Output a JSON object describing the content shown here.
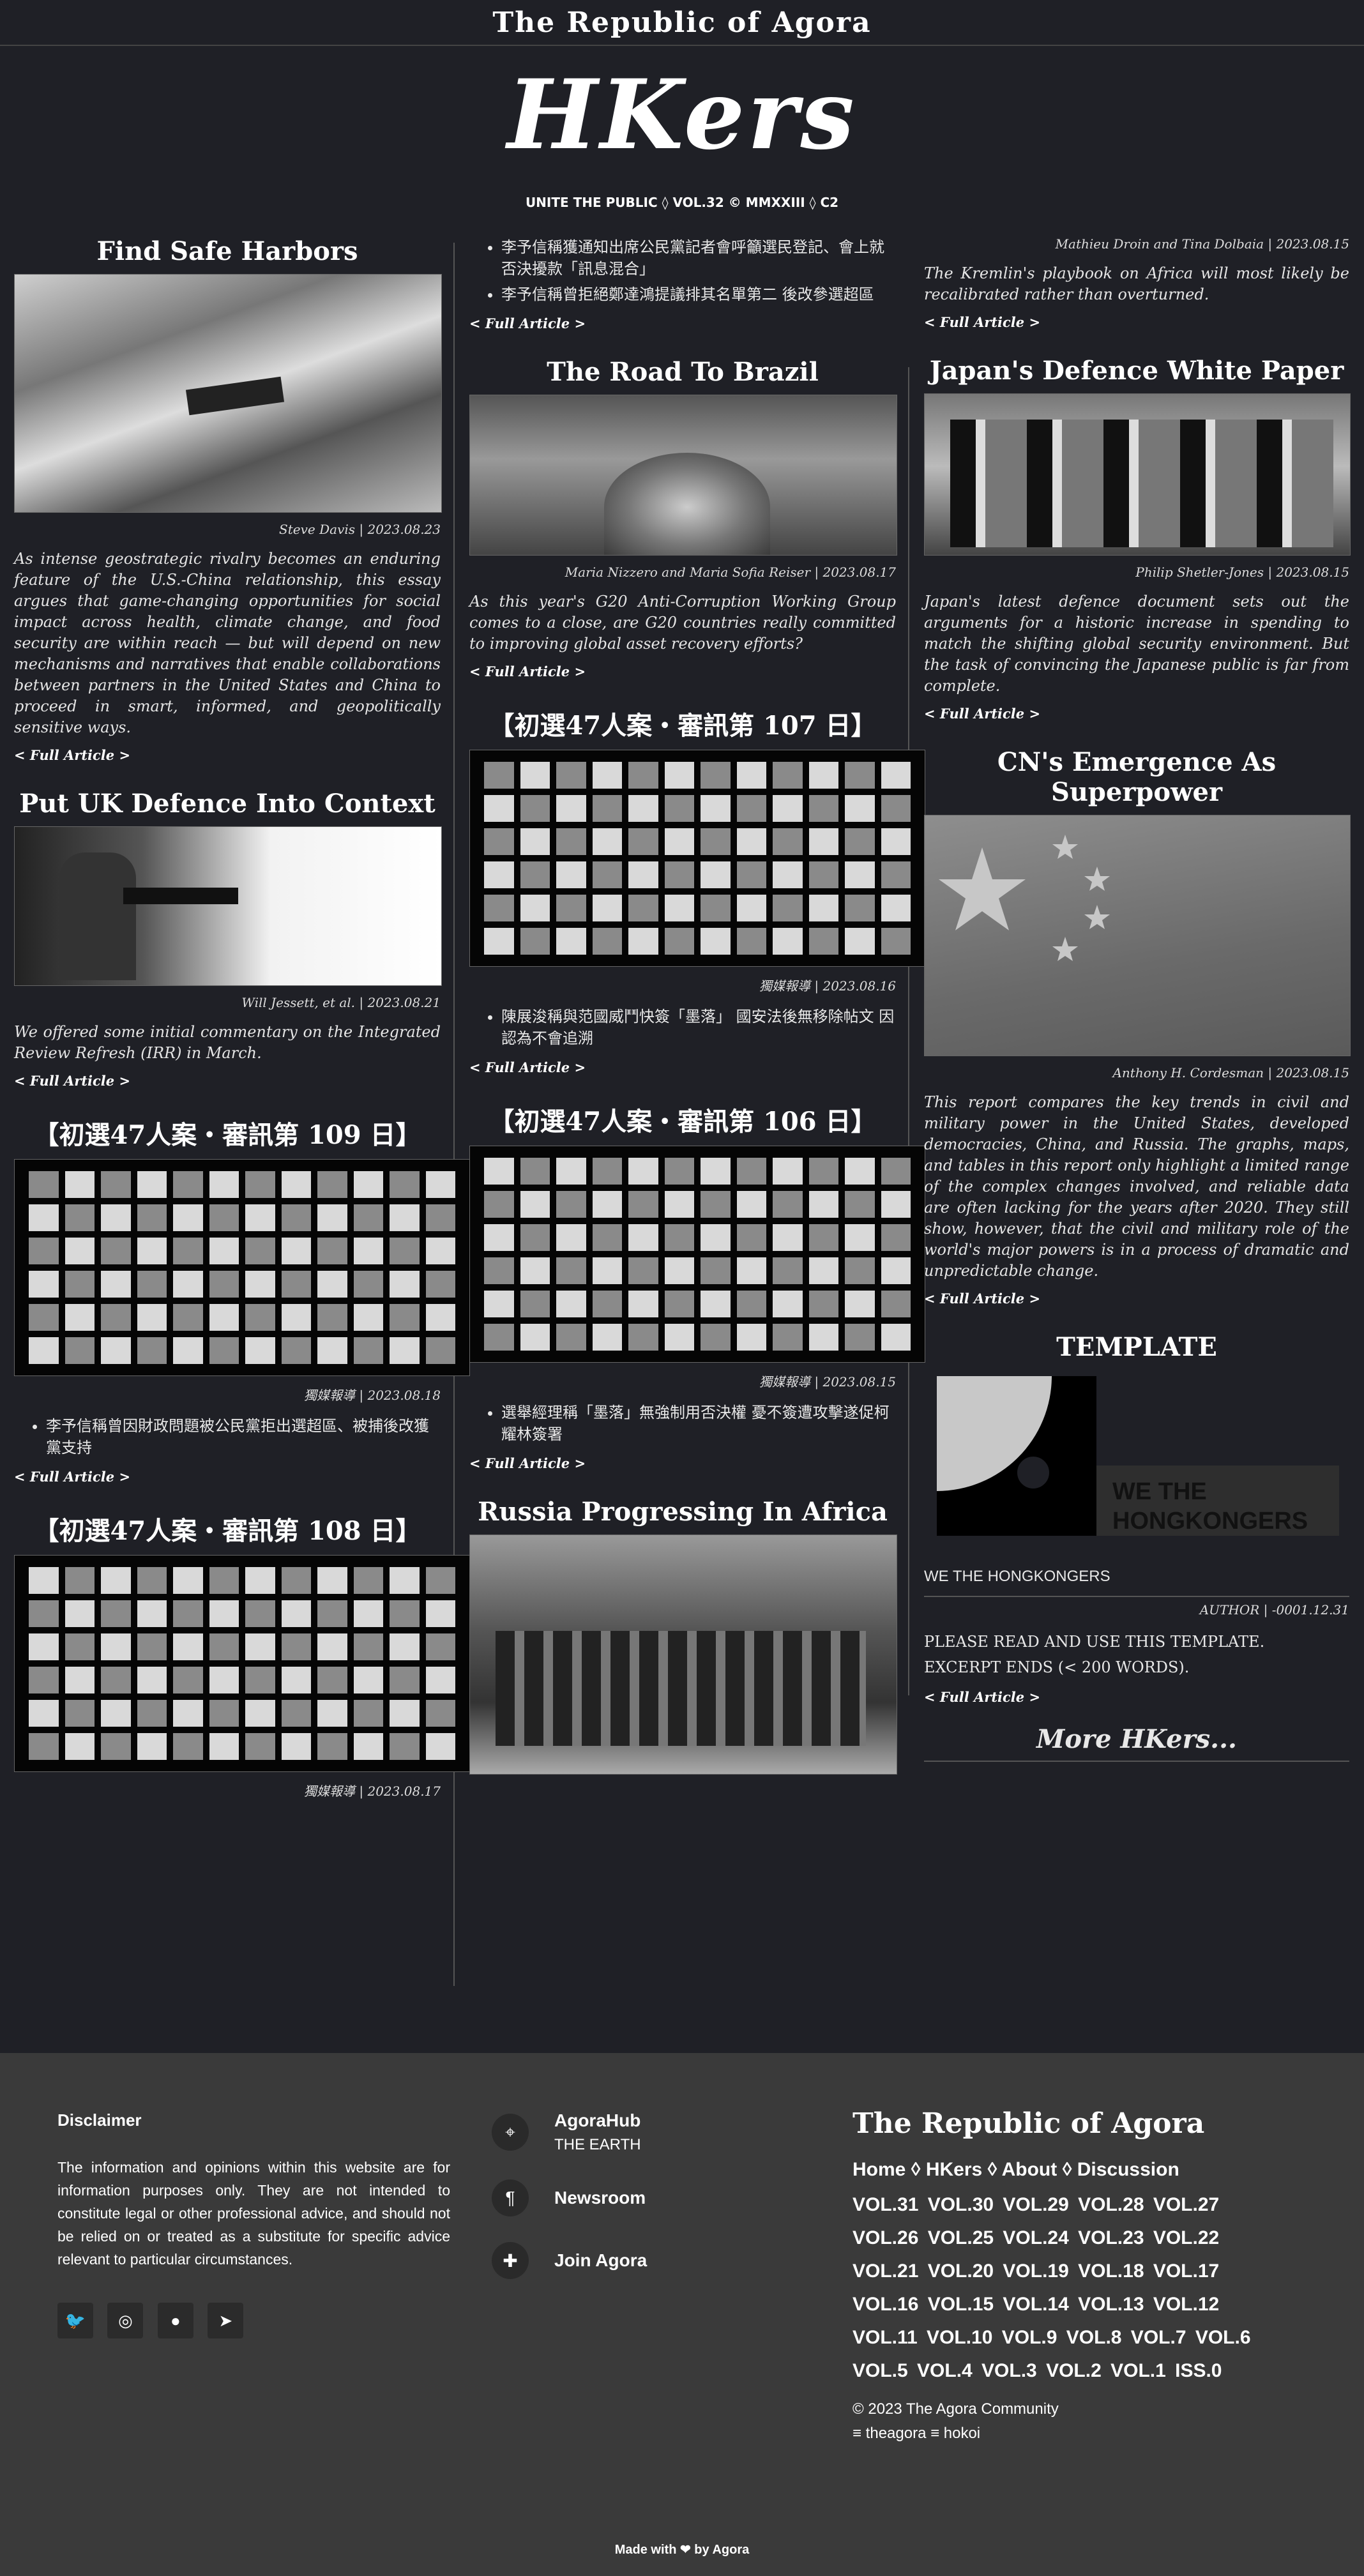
{
  "site": {
    "top_title": "The Republic of Agora",
    "logo": "HKers",
    "subtitle": "UNITE THE PUBLIC ◊ VOL.32 © MMXXIII ◊ C2"
  },
  "full_article": "< Full Article >",
  "col1": [
    {
      "title": "Find Safe Harbors",
      "meta": "Steve Davis | 2023.08.23",
      "excerpt": "As intense geostrategic rivalry becomes an enduring feature of the U.S.-China relationship, this essay argues that game-changing opportunities for social impact across health, climate change, and food security are within reach — but will depend on new mechanisms and narratives that enable collaborations between partners in the United States and China to proceed in smart, informed, and geopolitically sensitive ways."
    },
    {
      "title": "Put UK Defence Into Context",
      "meta": "Will Jessett, et al. | 2023.08.21",
      "excerpt": "We offered some initial commentary on the Integrated Review Refresh (IRR) in March."
    },
    {
      "title": "【初選47人案・審訊第 109 日】",
      "meta": "獨媒報導 | 2023.08.18",
      "bullets": [
        "李予信稱曾因財政問題被公民黨拒出選超區、被捕後改獲黨支持"
      ]
    },
    {
      "title": "【初選47人案・審訊第 108 日】",
      "meta": "獨媒報導 | 2023.08.17"
    }
  ],
  "col2": [
    {
      "bullets": [
        "李予信稱獲通知出席公民黨記者會呼籲選民登記、會上就否決擾款「訊息混合」",
        "李予信稱曾拒絕鄭達鴻提議排其名單第二 後改參選超區"
      ]
    },
    {
      "title": "The Road To Brazil",
      "meta": "Maria Nizzero and Maria Sofia Reiser | 2023.08.17",
      "excerpt": "As this year's G20 Anti-Corruption Working Group comes to a close, are G20 countries really committed to improving global asset recovery efforts?"
    },
    {
      "title": "【初選47人案・審訊第 107 日】",
      "meta": "獨媒報導 | 2023.08.16",
      "bullets": [
        "陳展浚稱與范國威鬥快簽「墨落」 國安法後無移除帖文 因認為不會追溯"
      ]
    },
    {
      "title": "【初選47人案・審訊第 106 日】",
      "meta": "獨媒報導 | 2023.08.15",
      "bullets": [
        "選舉經理稱「墨落」無強制用否決權 憂不簽遭攻擊遂促柯耀林簽署"
      ]
    },
    {
      "title": "Russia Progressing In Africa"
    }
  ],
  "col3": [
    {
      "meta": "Mathieu Droin and Tina Dolbaia | 2023.08.15",
      "excerpt": "The Kremlin's playbook on Africa will most likely be recalibrated rather than overturned."
    },
    {
      "title": "Japan's Defence White Paper",
      "meta": "Philip Shetler-Jones | 2023.08.15",
      "excerpt": "Japan's latest defence document sets out the arguments for a historic increase in spending to match the shifting global security environment. But the task of convincing the Japanese public is far from complete."
    },
    {
      "title": "CN's Emergence As Superpower",
      "meta": "Anthony H. Cordesman | 2023.08.15",
      "excerpt": "This report compares the key trends in civil and military power in the United States, developed democracies, China, and Russia. The graphs, maps, and tables in this report only highlight a limited range of the complex changes involved, and reliable data are often lacking for the years after 2020. They still show, however, that the civil and military role of the world's major powers is in a process of dramatic and unpredictable change."
    },
    {
      "title": "TEMPLATE",
      "image_text": "WE THE HONGKONGERS",
      "caption": "WE THE HONGKONGERS",
      "meta": "AUTHOR | -0001.12.31",
      "lines": [
        "PLEASE READ AND USE THIS TEMPLATE.",
        "EXCERPT ENDS (< 200 WORDS)."
      ]
    }
  ],
  "more": "More HKers...",
  "footer": {
    "disclaimer_title": "Disclaimer",
    "disclaimer_text": "The information and opinions within this website are for information purposes only. They are not intended to constitute legal or other professional advice, and should not be relied on or treated as a substitute for specific advice relevant to particular circumstances.",
    "hub_title": "AgoraHub",
    "hub_sub": "THE EARTH",
    "newsroom": "Newsroom",
    "join": "Join Agora",
    "brand": "The Republic of Agora",
    "nav": "Home ◊ HKers ◊ About ◊ Discussion",
    "vols": "VOL.31 VOL.30 VOL.29 VOL.28 VOL.27 VOL.26 VOL.25 VOL.24 VOL.23 VOL.22 VOL.21 VOL.20 VOL.19 VOL.18 VOL.17 VOL.16 VOL.15 VOL.14 VOL.13 VOL.12 VOL.11 VOL.10 VOL.9 VOL.8 VOL.7 VOL.6 VOL.5 VOL.4 VOL.3 VOL.2 VOL.1 ISS.0",
    "copyright": "© 2023 The Agora Community",
    "links": "≡ theagora ≡ hokoi",
    "made_with": "Made with ❤ by Agora"
  }
}
